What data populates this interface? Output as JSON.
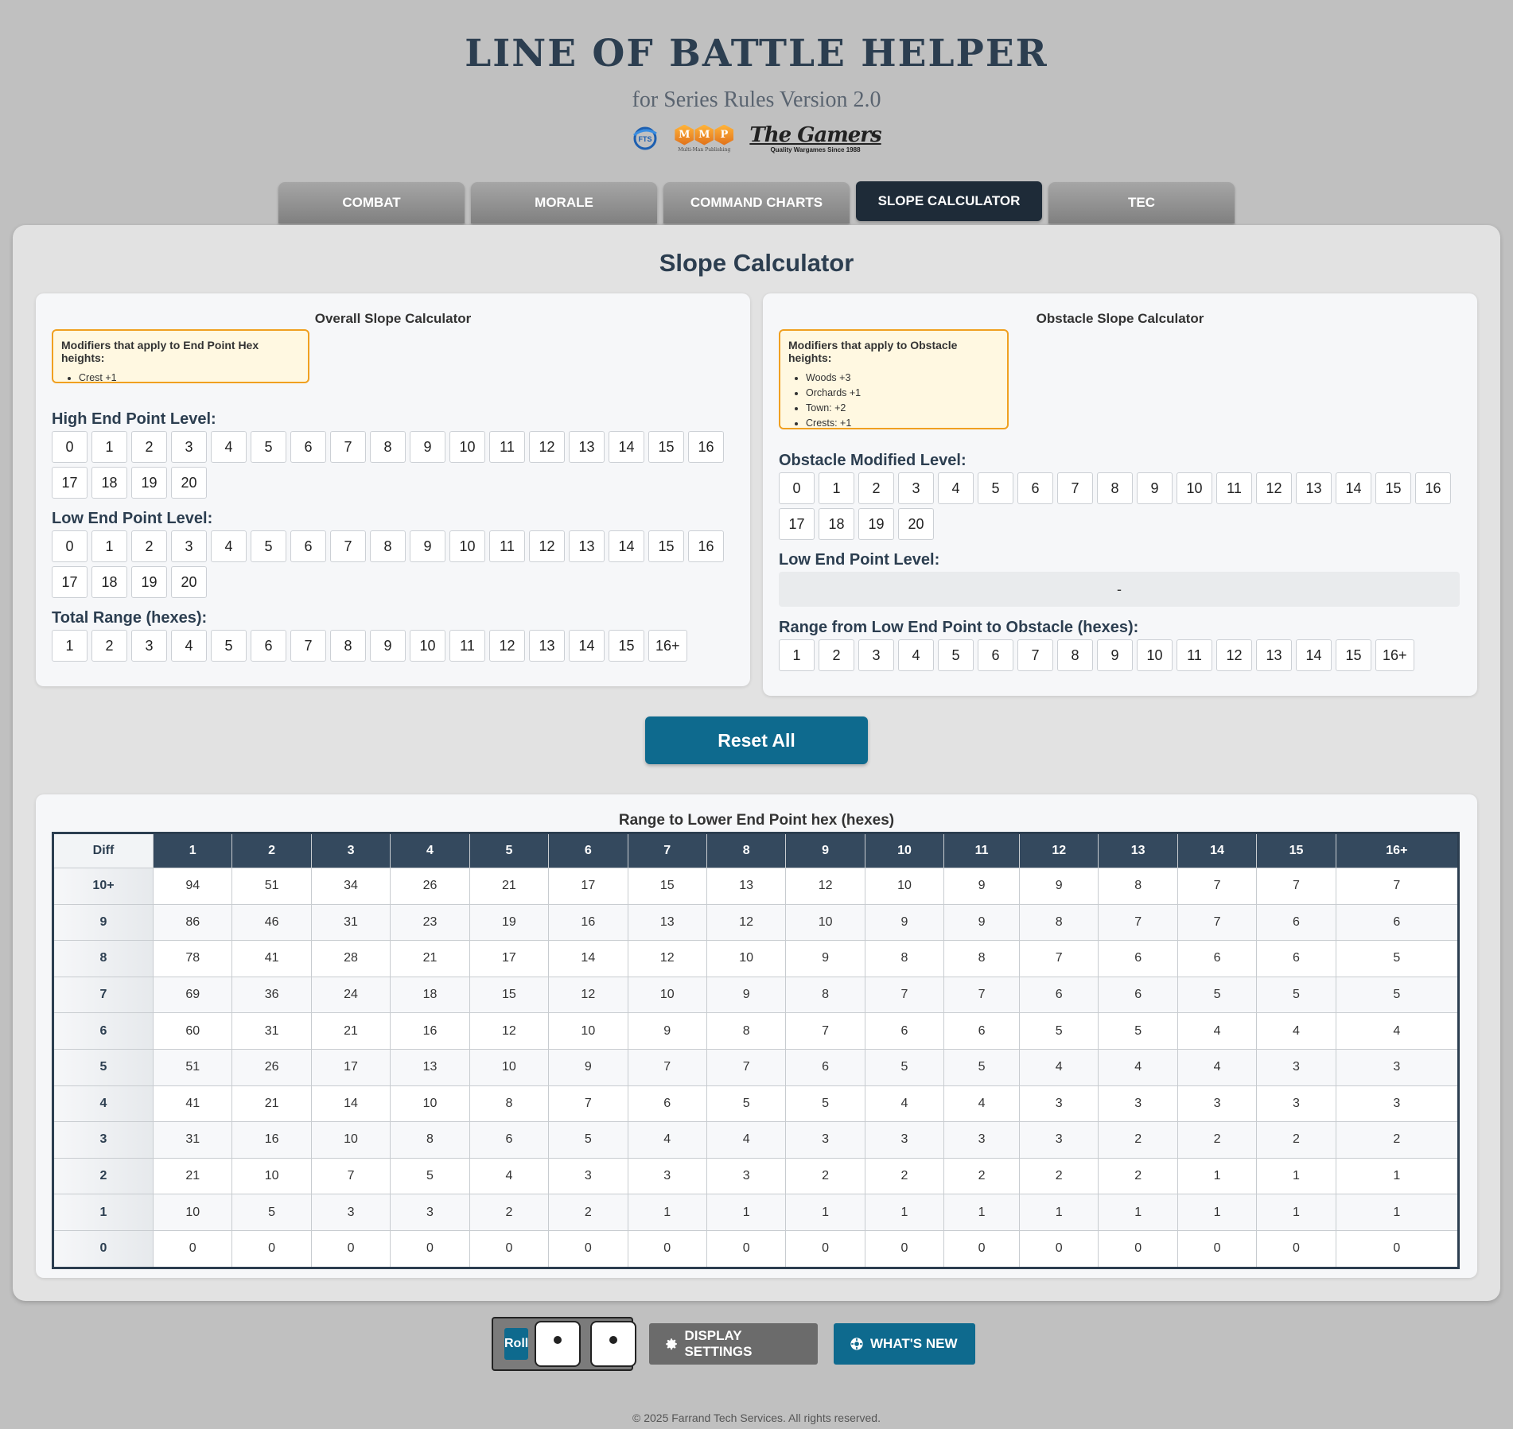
{
  "header": {
    "title": "LINE OF BATTLE HELPER",
    "subtitle": "for Series Rules Version 2.0",
    "logos": {
      "fts": "FTS",
      "mmp_letters": [
        "M",
        "M",
        "P"
      ],
      "mmp_sub": "Multi-Man Publishing",
      "gamers_main": "The Gamers",
      "gamers_sub": "Quality Wargames Since 1988"
    }
  },
  "tabs": [
    "COMBAT",
    "MORALE",
    "COMMAND CHARTS",
    "SLOPE CALCULATOR",
    "TEC"
  ],
  "active_tab": "SLOPE CALCULATOR",
  "page_title": "Slope Calculator",
  "overall": {
    "title": "Overall Slope Calculator",
    "modifiers_title": "Modifiers that apply to End Point Hex heights:",
    "modifiers": [
      "Crest +1"
    ],
    "high_label": "High End Point Level:",
    "low_label": "Low End Point Level:",
    "range_label": "Total Range (hexes):"
  },
  "obstacle": {
    "title": "Obstacle Slope Calculator",
    "modifiers_title": "Modifiers that apply to Obstacle heights:",
    "modifiers": [
      "Woods +3",
      "Orchards +1",
      "Town: +2",
      "Crests: +1"
    ],
    "modified_label": "Obstacle Modified Level:",
    "low_label": "Low End Point Level:",
    "low_value": "-",
    "range_label": "Range from Low End Point to Obstacle (hexes):"
  },
  "levels": [
    "0",
    "1",
    "2",
    "3",
    "4",
    "5",
    "6",
    "7",
    "8",
    "9",
    "10",
    "11",
    "12",
    "13",
    "14",
    "15",
    "16",
    "17",
    "18",
    "19",
    "20"
  ],
  "ranges": [
    "1",
    "2",
    "3",
    "4",
    "5",
    "6",
    "7",
    "8",
    "9",
    "10",
    "11",
    "12",
    "13",
    "14",
    "15",
    "16+"
  ],
  "reset_label": "Reset All",
  "table": {
    "caption": "Range to Lower End Point hex (hexes)",
    "corner": "Diff",
    "columns": [
      "1",
      "2",
      "3",
      "4",
      "5",
      "6",
      "7",
      "8",
      "9",
      "10",
      "11",
      "12",
      "13",
      "14",
      "15",
      "16+"
    ],
    "rows": [
      {
        "diff": "10+",
        "values": [
          "94",
          "51",
          "34",
          "26",
          "21",
          "17",
          "15",
          "13",
          "12",
          "10",
          "9",
          "9",
          "8",
          "7",
          "7",
          "7"
        ]
      },
      {
        "diff": "9",
        "values": [
          "86",
          "46",
          "31",
          "23",
          "19",
          "16",
          "13",
          "12",
          "10",
          "9",
          "9",
          "8",
          "7",
          "7",
          "6",
          "6"
        ]
      },
      {
        "diff": "8",
        "values": [
          "78",
          "41",
          "28",
          "21",
          "17",
          "14",
          "12",
          "10",
          "9",
          "8",
          "8",
          "7",
          "6",
          "6",
          "6",
          "5"
        ]
      },
      {
        "diff": "7",
        "values": [
          "69",
          "36",
          "24",
          "18",
          "15",
          "12",
          "10",
          "9",
          "8",
          "7",
          "7",
          "6",
          "6",
          "5",
          "5",
          "5"
        ]
      },
      {
        "diff": "6",
        "values": [
          "60",
          "31",
          "21",
          "16",
          "12",
          "10",
          "9",
          "8",
          "7",
          "6",
          "6",
          "5",
          "5",
          "4",
          "4",
          "4"
        ]
      },
      {
        "diff": "5",
        "values": [
          "51",
          "26",
          "17",
          "13",
          "10",
          "9",
          "7",
          "7",
          "6",
          "5",
          "5",
          "4",
          "4",
          "4",
          "3",
          "3"
        ]
      },
      {
        "diff": "4",
        "values": [
          "41",
          "21",
          "14",
          "10",
          "8",
          "7",
          "6",
          "5",
          "5",
          "4",
          "4",
          "3",
          "3",
          "3",
          "3",
          "3"
        ]
      },
      {
        "diff": "3",
        "values": [
          "31",
          "16",
          "10",
          "8",
          "6",
          "5",
          "4",
          "4",
          "3",
          "3",
          "3",
          "3",
          "2",
          "2",
          "2",
          "2"
        ]
      },
      {
        "diff": "2",
        "values": [
          "21",
          "10",
          "7",
          "5",
          "4",
          "3",
          "3",
          "3",
          "2",
          "2",
          "2",
          "2",
          "2",
          "1",
          "1",
          "1"
        ]
      },
      {
        "diff": "1",
        "values": [
          "10",
          "5",
          "3",
          "3",
          "2",
          "2",
          "1",
          "1",
          "1",
          "1",
          "1",
          "1",
          "1",
          "1",
          "1",
          "1"
        ]
      },
      {
        "diff": "0",
        "values": [
          "0",
          "0",
          "0",
          "0",
          "0",
          "0",
          "0",
          "0",
          "0",
          "0",
          "0",
          "0",
          "0",
          "0",
          "0",
          "0"
        ]
      }
    ]
  },
  "footer": {
    "roll_label": "Roll",
    "dice": [
      1,
      1
    ],
    "settings_label": "DISPLAY SETTINGS",
    "settings_icon": "gear-icon",
    "whatsnew_label": "WHAT'S NEW",
    "whatsnew_icon": "badge-gear-icon",
    "copyright": "© 2025 Farrand Tech Services. All rights reserved."
  },
  "colors": {
    "accent": "#0e6a8e",
    "dark": "#2c3e50",
    "tab_active": "#1e2b38",
    "modifier_border": "#f0a020"
  }
}
